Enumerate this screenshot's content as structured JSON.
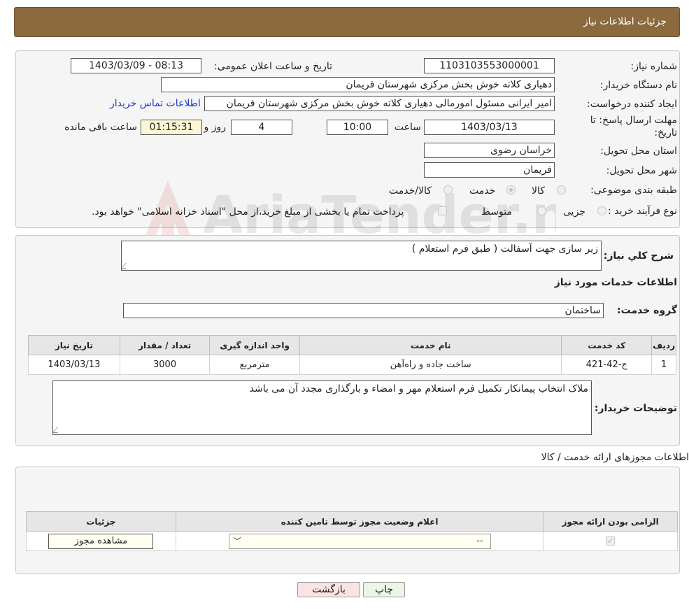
{
  "header": {
    "title": "جزئیات اطلاعات نیاز"
  },
  "fields": {
    "need_number_label": "شماره نیاز:",
    "need_number": "1103103553000001",
    "announce_label": "تاریخ و ساعت اعلان عمومی:",
    "announce_value": "1403/03/09 - 08:13",
    "buyer_org_label": "نام دستگاه خریدار:",
    "buyer_org": "دهیاری کلاته خوش بخش مرکزی شهرستان فریمان",
    "requester_label": "ایجاد کننده درخواست:",
    "requester": "امیر ایرانی مسئول امورمالی دهیاری کلاته خوش بخش مرکزی شهرستان فریمان",
    "contact_link": "اطلاعات تماس خریدار",
    "deadline_label_1": "مهلت ارسال پاسخ: تا",
    "deadline_label_2": "تاریخ:",
    "deadline_date": "1403/03/13",
    "time_label": "ساعت",
    "deadline_time": "10:00",
    "days": "4",
    "days_label": "روز و",
    "remaining": "01:15:31",
    "remaining_label": "ساعت باقی مانده",
    "province_label": "استان محل تحویل:",
    "province": "خراسان رضوی",
    "city_label": "شهر محل تحویل:",
    "city": "فریمان",
    "category_label": "طبقه بندی موضوعی:",
    "category_options": [
      "کالا",
      "خدمت",
      "کالا/خدمت"
    ],
    "process_label": "نوع فرآیند خرید :",
    "process_options": [
      "جزیی",
      "متوسط"
    ],
    "process_note": "پرداخت تمام یا بخشی از مبلغ خرید،از محل \"اسناد خزانه اسلامی\" خواهد بود."
  },
  "summary": {
    "label": "شرح کلي نياز:",
    "text": "زیر سازی جهت آسفالت ( طبق فرم استعلام )",
    "services_heading": "اطلاعات خدمات مورد نياز",
    "service_group_label": "گروه خدمت:",
    "service_group": "ساختمان"
  },
  "services_table": {
    "headers": [
      "رديف",
      "کد خدمت",
      "نام خدمت",
      "واحد اندازه گیری",
      "تعداد / مقدار",
      "تاریخ نیاز"
    ],
    "rows": [
      [
        "1",
        "ج-42-421",
        "ساخت جاده و راه‌آهن",
        "مترمربع",
        "3000",
        "1403/03/13"
      ]
    ]
  },
  "buyer_notes": {
    "label": "توضیحات خریدار:",
    "text": "ملاک انتخاب پیمانکار تکمیل فرم استعلام مهر و امضاء و بارگذاری مجدد آن می باشد"
  },
  "licenses": {
    "title": "اطلاعات مجوزهای ارائه خدمت / کالا",
    "headers": [
      "الزامی بودن ارائه مجوز",
      "اعلام وضعیت مجوز توسط تامین کننده",
      "جزئیات"
    ],
    "select_value": "--",
    "view_button": "مشاهده مجوز"
  },
  "buttons": {
    "print": "چاپ",
    "back": "بازگشت"
  },
  "watermark": {
    "text": "AriaTender.neT"
  },
  "colors": {
    "header_bg": "#8b6a3e",
    "link": "#1a37c9",
    "print_btn": "#eaf7e4",
    "back_btn": "#fbe3e3"
  }
}
